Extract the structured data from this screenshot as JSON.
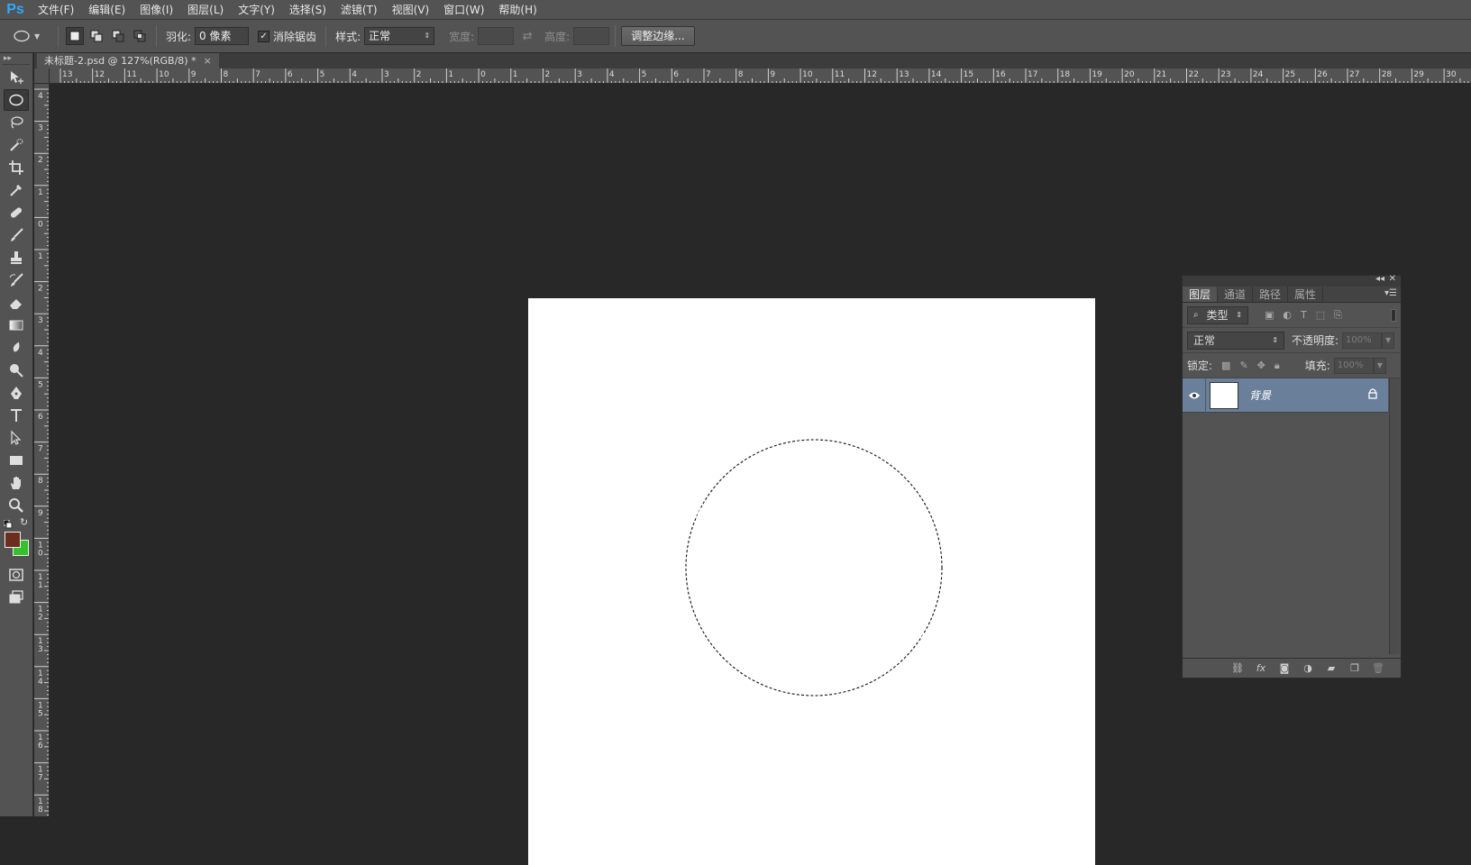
{
  "app": {
    "logo": "Ps"
  },
  "menu": [
    "文件(F)",
    "编辑(E)",
    "图像(I)",
    "图层(L)",
    "文字(Y)",
    "选择(S)",
    "滤镜(T)",
    "视图(V)",
    "窗口(W)",
    "帮助(H)"
  ],
  "options": {
    "feather_label": "羽化:",
    "feather_value": "0 像素",
    "antialias_label": "消除锯齿",
    "antialias_checked": true,
    "style_label": "样式:",
    "style_value": "正常",
    "width_label": "宽度:",
    "height_label": "高度:",
    "refine_edge_label": "调整边缘..."
  },
  "document": {
    "tab_title": "未标题-2.psd @ 127%(RGB/8) *",
    "tab_close": "×"
  },
  "rulers": {
    "horizontal": [
      "13",
      "12",
      "11",
      "10",
      "9",
      "8",
      "7",
      "6",
      "5",
      "4",
      "3",
      "2",
      "1",
      "0",
      "1",
      "2",
      "3",
      "4",
      "5",
      "6",
      "7",
      "8",
      "9",
      "10",
      "11",
      "12",
      "13",
      "14",
      "15",
      "16",
      "17",
      "18",
      "19",
      "20",
      "21",
      "22",
      "23",
      "24",
      "25",
      "26",
      "27",
      "28",
      "29",
      "30"
    ],
    "vertical": [
      "4",
      "3",
      "2",
      "1",
      "0",
      "1",
      "2",
      "3",
      "4",
      "5",
      "6",
      "7",
      "8",
      "9",
      "10",
      "11",
      "12",
      "13",
      "14",
      "15",
      "16",
      "17",
      "18"
    ]
  },
  "tools": [
    "move-tool",
    "elliptical-marquee-tool",
    "lasso-tool",
    "quick-selection-tool",
    "crop-tool",
    "eyedropper-tool",
    "healing-brush-tool",
    "brush-tool",
    "clone-stamp-tool",
    "history-brush-tool",
    "eraser-tool",
    "gradient-tool",
    "blur-tool",
    "dodge-tool",
    "pen-tool",
    "type-tool",
    "path-selection-tool",
    "rectangle-tool",
    "hand-tool",
    "zoom-tool"
  ],
  "colors": {
    "foreground": "#6b2e1e",
    "background": "#35c12d",
    "canvas": "#ffffff",
    "selected_layer": "#6a7f99"
  },
  "layers_panel": {
    "tabs": [
      "图层",
      "通道",
      "路径",
      "属性"
    ],
    "active_tab": 0,
    "filter_label": "类型",
    "blend_mode": "正常",
    "opacity_label": "不透明度:",
    "opacity_value": "100%",
    "lock_label": "锁定:",
    "fill_label": "填充:",
    "fill_value": "100%",
    "layers": [
      {
        "name": "背景",
        "visible": true,
        "locked": true,
        "selected": true
      }
    ]
  }
}
